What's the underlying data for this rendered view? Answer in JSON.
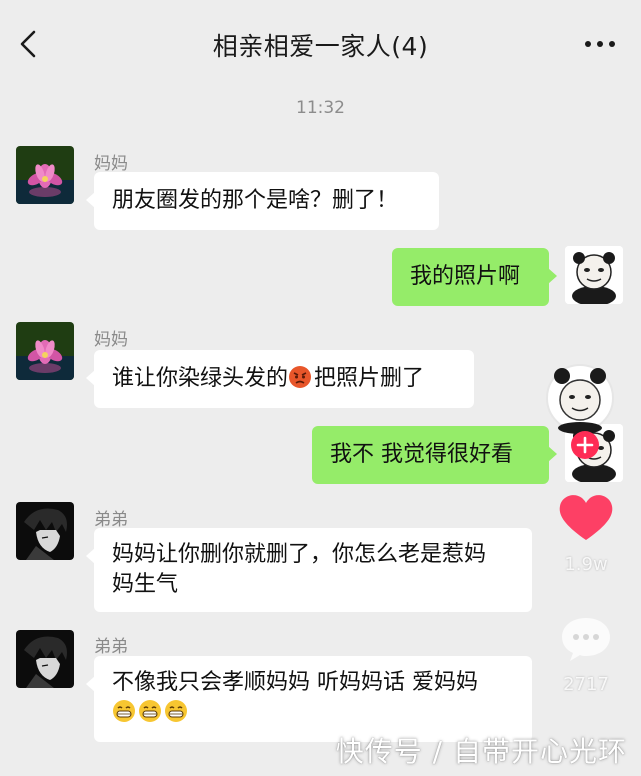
{
  "header": {
    "title": "相亲相爱一家人(4)"
  },
  "chat": {
    "time": "11:32",
    "messages": [
      {
        "sender": "妈妈",
        "text": "朋友圈发的那个是啥？删了！"
      },
      {
        "text": "我的照片啊"
      },
      {
        "sender": "妈妈",
        "text_before": "谁让你染绿头发的",
        "emoji": "angry-face-emoji",
        "text_after": "把照片删了"
      },
      {
        "text": "我不 我觉得很好看"
      },
      {
        "sender": "弟弟",
        "line1": "妈妈让你删你就删了，你怎么老是惹妈",
        "line2": "妈生气"
      },
      {
        "sender": "弟弟",
        "text": "不像我只会孝顺妈妈 听妈妈话 爱妈妈",
        "emojis": [
          "grin-emoji",
          "grin-emoji",
          "grin-emoji"
        ]
      }
    ]
  },
  "overlay": {
    "like_count": "1.9w",
    "comment_count": "2717",
    "like_color": "#fe2c55"
  },
  "watermark": "快传号 / 自带开心光环"
}
